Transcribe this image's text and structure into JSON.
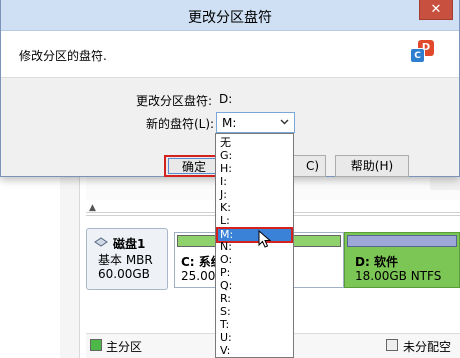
{
  "background": {
    "disk": {
      "name": "磁盘1",
      "type": "基本 MBR",
      "size": "60.00GB"
    },
    "partition_c": {
      "name": "C: 系统",
      "size": "25.00G"
    },
    "partition_d": {
      "name": "D: 软件",
      "size": "18.00GB NTFS"
    },
    "legend": {
      "primary": "主分区",
      "unallocated": "未分配空"
    },
    "colors": {
      "primary_green": "#4db848",
      "partition_d_green": "#7cc655"
    }
  },
  "dialog": {
    "title": "更改分区盘符",
    "close_glyph": "✕",
    "header_text": "修改分区的盘符.",
    "old_letter_label": "更改分区盘符:",
    "old_letter_value": "D:",
    "new_letter_label": "新的盘符(L):",
    "new_letter_value": "M:",
    "buttons": {
      "ok": "确定(O)",
      "cancel": "C)",
      "help": "帮助(H)"
    },
    "logo_letters": {
      "back": "D",
      "front": "C"
    },
    "colors": {
      "titlebar": "#cfe0f4",
      "close": "#c7503f",
      "highlight": "#d3211e",
      "selection": "#3a82d8"
    }
  },
  "dropdown": {
    "options": [
      "无",
      "G:",
      "H:",
      "I:",
      "J:",
      "K:",
      "L:",
      "M:",
      "N:",
      "O:",
      "P:",
      "Q:",
      "R:",
      "S:",
      "T:",
      "U:",
      "V:"
    ],
    "selected": "M:"
  }
}
